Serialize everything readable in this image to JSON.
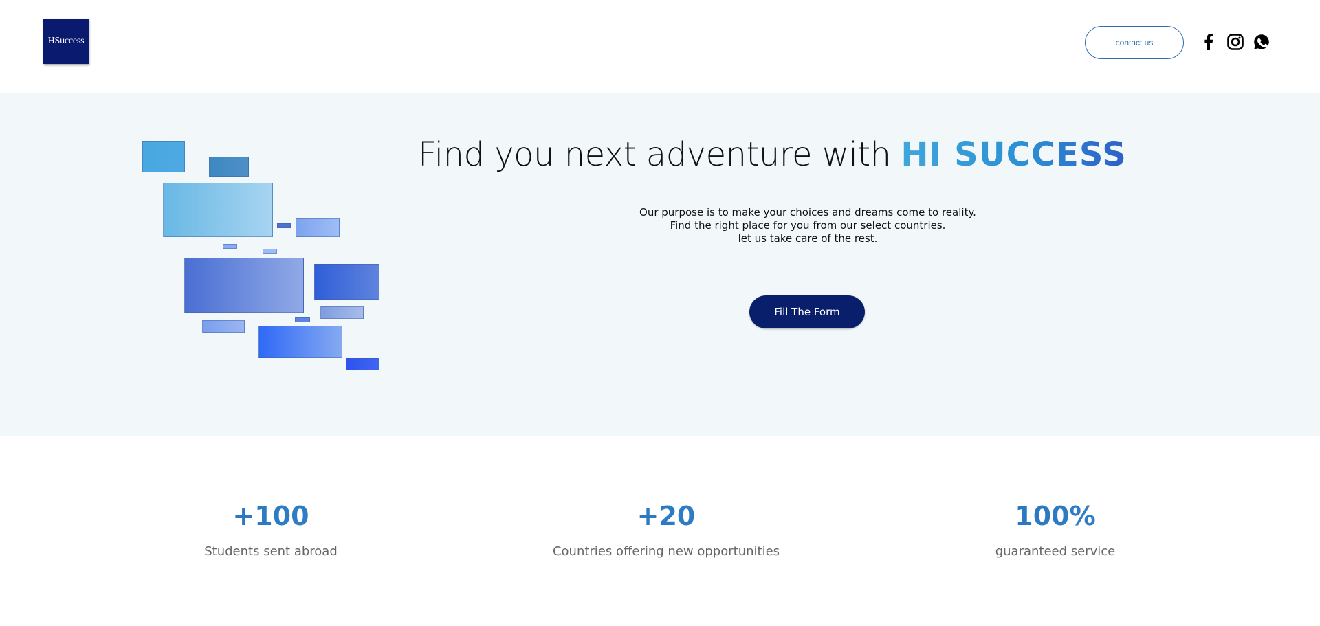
{
  "header": {
    "logo_text": "HSuccess",
    "contact_label": "contact us",
    "social_icons": [
      "facebook-icon",
      "instagram-icon",
      "whatsapp-icon"
    ]
  },
  "hero": {
    "title_prefix": "Find you next adventure with ",
    "title_brand": "HI SUCCESS",
    "lines": [
      "Our purpose is to make your choices and dreams come to reality.",
      "Find the right place for you from our select countries.",
      "let us take care of the rest."
    ],
    "cta_label": "Fill The Form"
  },
  "stats": [
    {
      "value": "+100",
      "label": "Students sent abroad"
    },
    {
      "value": "+20",
      "label": "Countries offering new opportunities"
    },
    {
      "value": "100%",
      "label": "guaranteed service"
    }
  ],
  "colors": {
    "primary_navy": "#0a1f6e",
    "accent_blue": "#2e6fb3",
    "hero_background": "#f2f7fa",
    "brand_gradient_start": "#3fa7dc",
    "brand_gradient_end": "#2e5fc7"
  }
}
